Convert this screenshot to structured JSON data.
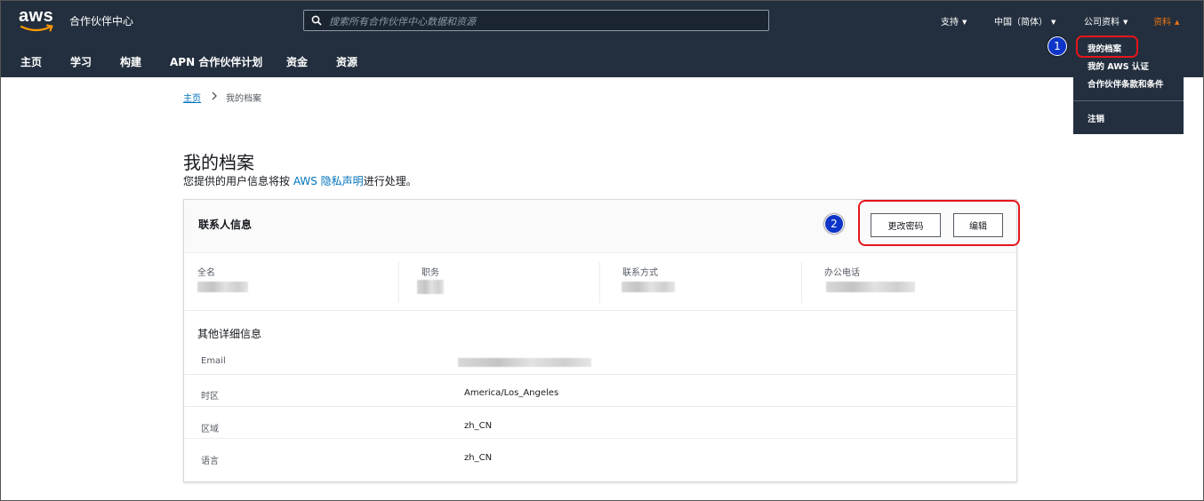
{
  "header": {
    "logo_text": "aws",
    "portal_title": "合作伙伴中心",
    "search_placeholder": "搜索所有合作伙伴中心数据和资源",
    "top_links": [
      {
        "label": "支持"
      },
      {
        "label": "中国（简体）"
      },
      {
        "label": "公司资料"
      },
      {
        "label": "资料"
      }
    ],
    "accent_color": "#ec7211"
  },
  "nav": {
    "items": [
      "主页",
      "学习",
      "构建",
      "APN 合作伙伴计划",
      "资金",
      "资源"
    ]
  },
  "profile_menu": {
    "items": [
      "我的档案",
      "我的 AWS 认证",
      "合作伙伴条款和条件",
      "注销"
    ]
  },
  "annotations": {
    "step1": "1",
    "step2": "2"
  },
  "breadcrumb": {
    "home": "主页",
    "current": "我的档案"
  },
  "page": {
    "title": "我的档案",
    "privacy_prefix": "您提供的用户信息将按 ",
    "privacy_link": "AWS 隐私声明",
    "privacy_suffix": "进行处理。"
  },
  "contact_card": {
    "title": "联系人信息",
    "change_password": "更改密码",
    "edit": "编辑",
    "fields": [
      "全名",
      "职务",
      "联系方式",
      "办公电话"
    ]
  },
  "details": {
    "title": "其他详细信息",
    "rows": [
      {
        "label": "Email",
        "value": ""
      },
      {
        "label": "时区",
        "value": "America/Los_Angeles"
      },
      {
        "label": "区域",
        "value": "zh_CN"
      },
      {
        "label": "语言",
        "value": "zh_CN"
      }
    ]
  }
}
